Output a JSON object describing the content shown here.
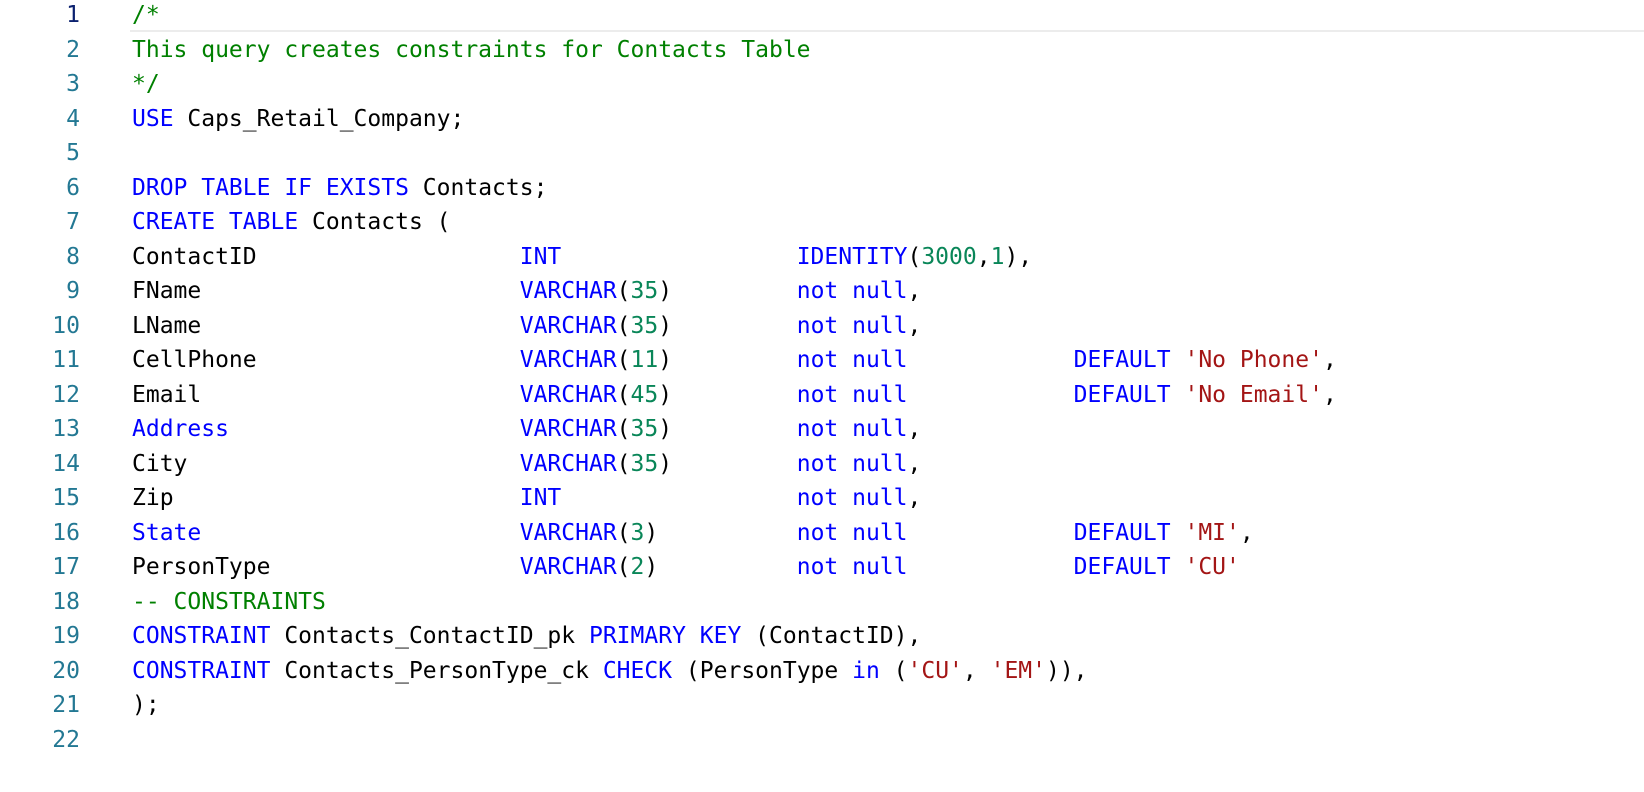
{
  "editor": {
    "colors": {
      "comment": "#008000",
      "keyword": "#0000ff",
      "number": "#098658",
      "string": "#a31515",
      "plain": "#000000",
      "line_number": "#237893",
      "active_line_number": "#0b216f"
    },
    "active_line": 1,
    "lines": [
      {
        "n": "1",
        "tokens": [
          {
            "t": "/*",
            "c": "comment"
          }
        ]
      },
      {
        "n": "2",
        "tokens": [
          {
            "t": "This query creates constraints for Contacts Table",
            "c": "comment"
          }
        ]
      },
      {
        "n": "3",
        "tokens": [
          {
            "t": "*/",
            "c": "comment"
          }
        ]
      },
      {
        "n": "4",
        "tokens": [
          {
            "t": "USE",
            "c": "keyword"
          },
          {
            "t": " Caps_Retail_Company;",
            "c": "plain"
          }
        ]
      },
      {
        "n": "5",
        "tokens": []
      },
      {
        "n": "6",
        "tokens": [
          {
            "t": "DROP TABLE IF EXISTS",
            "c": "keyword"
          },
          {
            "t": " Contacts;",
            "c": "plain"
          }
        ]
      },
      {
        "n": "7",
        "tokens": [
          {
            "t": "CREATE TABLE",
            "c": "keyword"
          },
          {
            "t": " Contacts (",
            "c": "plain"
          }
        ]
      },
      {
        "n": "8",
        "tokens": [
          {
            "t": "ContactID                   ",
            "c": "plain"
          },
          {
            "t": "INT",
            "c": "keyword"
          },
          {
            "t": "                 ",
            "c": "plain"
          },
          {
            "t": "IDENTITY",
            "c": "keyword"
          },
          {
            "t": "(",
            "c": "plain"
          },
          {
            "t": "3000",
            "c": "number"
          },
          {
            "t": ",",
            "c": "plain"
          },
          {
            "t": "1",
            "c": "number"
          },
          {
            "t": "),",
            "c": "plain"
          }
        ]
      },
      {
        "n": "9",
        "tokens": [
          {
            "t": "FName                       ",
            "c": "plain"
          },
          {
            "t": "VARCHAR",
            "c": "keyword"
          },
          {
            "t": "(",
            "c": "plain"
          },
          {
            "t": "35",
            "c": "number"
          },
          {
            "t": ")         ",
            "c": "plain"
          },
          {
            "t": "not null",
            "c": "keyword"
          },
          {
            "t": ",",
            "c": "plain"
          }
        ]
      },
      {
        "n": "10",
        "tokens": [
          {
            "t": "LName                       ",
            "c": "plain"
          },
          {
            "t": "VARCHAR",
            "c": "keyword"
          },
          {
            "t": "(",
            "c": "plain"
          },
          {
            "t": "35",
            "c": "number"
          },
          {
            "t": ")         ",
            "c": "plain"
          },
          {
            "t": "not null",
            "c": "keyword"
          },
          {
            "t": ",",
            "c": "plain"
          }
        ]
      },
      {
        "n": "11",
        "tokens": [
          {
            "t": "CellPhone                   ",
            "c": "plain"
          },
          {
            "t": "VARCHAR",
            "c": "keyword"
          },
          {
            "t": "(",
            "c": "plain"
          },
          {
            "t": "11",
            "c": "number"
          },
          {
            "t": ")         ",
            "c": "plain"
          },
          {
            "t": "not null",
            "c": "keyword"
          },
          {
            "t": "            ",
            "c": "plain"
          },
          {
            "t": "DEFAULT",
            "c": "keyword"
          },
          {
            "t": " ",
            "c": "plain"
          },
          {
            "t": "'No Phone'",
            "c": "string"
          },
          {
            "t": ",",
            "c": "plain"
          }
        ]
      },
      {
        "n": "12",
        "tokens": [
          {
            "t": "Email                       ",
            "c": "plain"
          },
          {
            "t": "VARCHAR",
            "c": "keyword"
          },
          {
            "t": "(",
            "c": "plain"
          },
          {
            "t": "45",
            "c": "number"
          },
          {
            "t": ")         ",
            "c": "plain"
          },
          {
            "t": "not null",
            "c": "keyword"
          },
          {
            "t": "            ",
            "c": "plain"
          },
          {
            "t": "DEFAULT",
            "c": "keyword"
          },
          {
            "t": " ",
            "c": "plain"
          },
          {
            "t": "'No Email'",
            "c": "string"
          },
          {
            "t": ",",
            "c": "plain"
          }
        ]
      },
      {
        "n": "13",
        "tokens": [
          {
            "t": "Address",
            "c": "keyword"
          },
          {
            "t": "                     ",
            "c": "plain"
          },
          {
            "t": "VARCHAR",
            "c": "keyword"
          },
          {
            "t": "(",
            "c": "plain"
          },
          {
            "t": "35",
            "c": "number"
          },
          {
            "t": ")         ",
            "c": "plain"
          },
          {
            "t": "not null",
            "c": "keyword"
          },
          {
            "t": ",",
            "c": "plain"
          }
        ]
      },
      {
        "n": "14",
        "tokens": [
          {
            "t": "City                        ",
            "c": "plain"
          },
          {
            "t": "VARCHAR",
            "c": "keyword"
          },
          {
            "t": "(",
            "c": "plain"
          },
          {
            "t": "35",
            "c": "number"
          },
          {
            "t": ")         ",
            "c": "plain"
          },
          {
            "t": "not null",
            "c": "keyword"
          },
          {
            "t": ",",
            "c": "plain"
          }
        ]
      },
      {
        "n": "15",
        "tokens": [
          {
            "t": "Zip                         ",
            "c": "plain"
          },
          {
            "t": "INT",
            "c": "keyword"
          },
          {
            "t": "                 ",
            "c": "plain"
          },
          {
            "t": "not null",
            "c": "keyword"
          },
          {
            "t": ",",
            "c": "plain"
          }
        ]
      },
      {
        "n": "16",
        "tokens": [
          {
            "t": "State",
            "c": "keyword"
          },
          {
            "t": "                       ",
            "c": "plain"
          },
          {
            "t": "VARCHAR",
            "c": "keyword"
          },
          {
            "t": "(",
            "c": "plain"
          },
          {
            "t": "3",
            "c": "number"
          },
          {
            "t": ")          ",
            "c": "plain"
          },
          {
            "t": "not null",
            "c": "keyword"
          },
          {
            "t": "            ",
            "c": "plain"
          },
          {
            "t": "DEFAULT",
            "c": "keyword"
          },
          {
            "t": " ",
            "c": "plain"
          },
          {
            "t": "'MI'",
            "c": "string"
          },
          {
            "t": ",",
            "c": "plain"
          }
        ]
      },
      {
        "n": "17",
        "tokens": [
          {
            "t": "PersonType                  ",
            "c": "plain"
          },
          {
            "t": "VARCHAR",
            "c": "keyword"
          },
          {
            "t": "(",
            "c": "plain"
          },
          {
            "t": "2",
            "c": "number"
          },
          {
            "t": ")          ",
            "c": "plain"
          },
          {
            "t": "not null",
            "c": "keyword"
          },
          {
            "t": "            ",
            "c": "plain"
          },
          {
            "t": "DEFAULT",
            "c": "keyword"
          },
          {
            "t": " ",
            "c": "plain"
          },
          {
            "t": "'CU'",
            "c": "string"
          }
        ]
      },
      {
        "n": "18",
        "tokens": [
          {
            "t": "-- CONSTRAINTS",
            "c": "comment"
          }
        ]
      },
      {
        "n": "19",
        "tokens": [
          {
            "t": "CONSTRAINT",
            "c": "keyword"
          },
          {
            "t": " Contacts_ContactID_pk ",
            "c": "plain"
          },
          {
            "t": "PRIMARY KEY",
            "c": "keyword"
          },
          {
            "t": " (ContactID),",
            "c": "plain"
          }
        ]
      },
      {
        "n": "20",
        "tokens": [
          {
            "t": "CONSTRAINT",
            "c": "keyword"
          },
          {
            "t": " Contacts_PersonType_ck ",
            "c": "plain"
          },
          {
            "t": "CHECK",
            "c": "keyword"
          },
          {
            "t": " (PersonType ",
            "c": "plain"
          },
          {
            "t": "in",
            "c": "keyword"
          },
          {
            "t": " (",
            "c": "plain"
          },
          {
            "t": "'CU'",
            "c": "string"
          },
          {
            "t": ", ",
            "c": "plain"
          },
          {
            "t": "'EM'",
            "c": "string"
          },
          {
            "t": ")),",
            "c": "plain"
          }
        ]
      },
      {
        "n": "21",
        "tokens": [
          {
            "t": ");",
            "c": "plain"
          }
        ]
      },
      {
        "n": "22",
        "tokens": []
      }
    ]
  }
}
